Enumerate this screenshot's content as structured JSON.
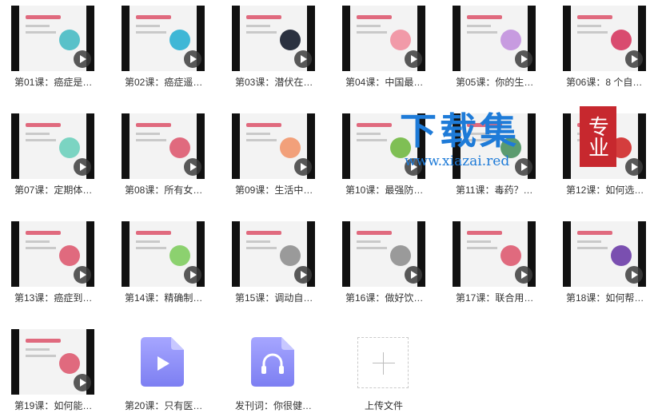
{
  "items": [
    {
      "label": "第01课：癌症是…",
      "kind": "video",
      "accent": "#e06a7e",
      "blob": "#59c1c9"
    },
    {
      "label": "第02课：癌症遥…",
      "kind": "video",
      "accent": "#e06a7e",
      "blob": "#3fb7d6"
    },
    {
      "label": "第03课：潜伏在…",
      "kind": "video",
      "accent": "#e06a7e",
      "blob": "#2a3140"
    },
    {
      "label": "第04课：中国最…",
      "kind": "video",
      "accent": "#e06a7e",
      "blob": "#f19aa8"
    },
    {
      "label": "第05课：你的生…",
      "kind": "video",
      "accent": "#e06a7e",
      "blob": "#c79be0"
    },
    {
      "label": "第06课：8 个自…",
      "kind": "video",
      "accent": "#e06a7e",
      "blob": "#d94b6f"
    },
    {
      "label": "第07课：定期体…",
      "kind": "video",
      "accent": "#e06a7e",
      "blob": "#7bd4c2"
    },
    {
      "label": "第08课：所有女…",
      "kind": "video",
      "accent": "#e06a7e",
      "blob": "#e06a7e"
    },
    {
      "label": "第09课：生活中…",
      "kind": "video",
      "accent": "#e06a7e",
      "blob": "#f2a07a"
    },
    {
      "label": "第10课：最强防…",
      "kind": "video",
      "accent": "#e06a7e",
      "blob": "#7fbf54"
    },
    {
      "label": "第11课：毒药？…",
      "kind": "video",
      "accent": "#e06a7e",
      "blob": "#5b9b6f"
    },
    {
      "label": "第12课：如何选…",
      "kind": "video",
      "accent": "#e06a7e",
      "blob": "#d43d3d"
    },
    {
      "label": "第13课：癌症到…",
      "kind": "video",
      "accent": "#e06a7e",
      "blob": "#e06a7e"
    },
    {
      "label": "第14课：精确制…",
      "kind": "video",
      "accent": "#e06a7e",
      "blob": "#8cd16f"
    },
    {
      "label": "第15课：调动自…",
      "kind": "video",
      "accent": "#e06a7e",
      "blob": "#9a9a9a"
    },
    {
      "label": "第16课：做好饮…",
      "kind": "video",
      "accent": "#e06a7e",
      "blob": "#9a9a9a"
    },
    {
      "label": "第17课：联合用…",
      "kind": "video",
      "accent": "#e06a7e",
      "blob": "#e06a7e"
    },
    {
      "label": "第18课：如何帮…",
      "kind": "video",
      "accent": "#e06a7e",
      "blob": "#7a4fb0"
    },
    {
      "label": "第19课：如何能…",
      "kind": "video",
      "accent": "#e06a7e",
      "blob": "#e06a7e"
    },
    {
      "label": "第20课：只有医…",
      "kind": "file-video",
      "accent": "#8a8cf5",
      "blob": ""
    },
    {
      "label": "发刊词：你很健…",
      "kind": "file-audio",
      "accent": "#8a8cf5",
      "blob": ""
    },
    {
      "label": "上传文件",
      "kind": "upload",
      "accent": "#bcbcbc",
      "blob": ""
    }
  ],
  "watermark": {
    "text": "下载集",
    "badge": "专业",
    "url": "www.xiazai.red",
    "color": "#1e7bd8",
    "badge_color": "#c7282e"
  }
}
